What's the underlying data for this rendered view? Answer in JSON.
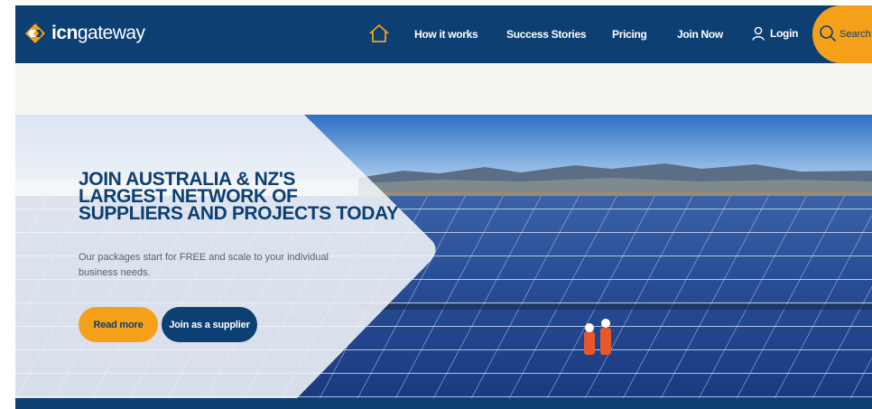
{
  "brand": {
    "logo_bold": "icn",
    "logo_light": "gateway"
  },
  "nav": {
    "items": [
      {
        "label": "How it works"
      },
      {
        "label": "Success Stories"
      },
      {
        "label": "Pricing"
      },
      {
        "label": "Join Now"
      }
    ],
    "login_label": "Login",
    "search_label": "Search"
  },
  "hero": {
    "title_lines": [
      "JOIN AUSTRALIA & NZ'S",
      "LARGEST NETWORK OF",
      "SUPPLIERS AND PROJECTS TODAY"
    ],
    "subtitle": "Our packages start for FREE and scale to your individual business needs.",
    "read_more_label": "Read more",
    "join_supplier_label": "Join as a supplier"
  },
  "colors": {
    "navy": "#0d3f73",
    "orange": "#f5a01a",
    "background": "#f6f4f1"
  },
  "icons": {
    "logo": "icn-diamond-logo-icon",
    "home": "home-icon",
    "login": "user-icon",
    "search": "search-icon"
  }
}
